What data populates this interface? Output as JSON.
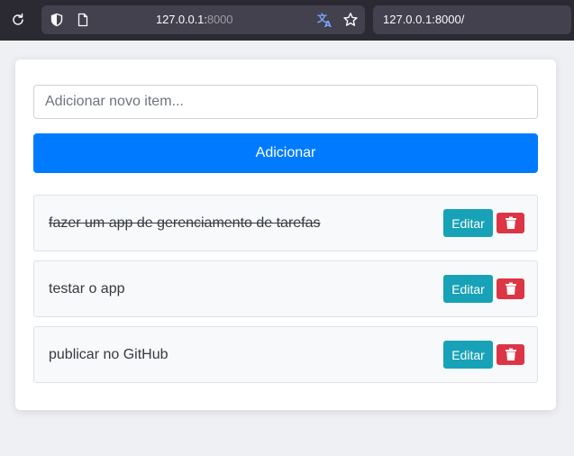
{
  "browser": {
    "url_host": "127.0.0.1:",
    "url_port": "8000",
    "url_full": "127.0.0.1:8000/",
    "icons": [
      "reload-icon",
      "shield-icon",
      "page-icon",
      "translate-icon",
      "star-icon"
    ]
  },
  "form": {
    "input_placeholder": "Adicionar novo item...",
    "input_value": "",
    "add_label": "Adicionar"
  },
  "items": [
    {
      "text": "fazer um app de gerenciamento de tarefas",
      "completed": true,
      "edit_label": "Editar",
      "delete_icon": "trash-icon"
    },
    {
      "text": "testar o app",
      "completed": false,
      "edit_label": "Editar",
      "delete_icon": "trash-icon"
    },
    {
      "text": "publicar no GitHub",
      "completed": false,
      "edit_label": "Editar",
      "delete_icon": "trash-icon"
    }
  ],
  "colors": {
    "primary": "#007bff",
    "info": "#17a2b8",
    "danger": "#dc3545",
    "browser_chrome": "#2b2a33"
  }
}
